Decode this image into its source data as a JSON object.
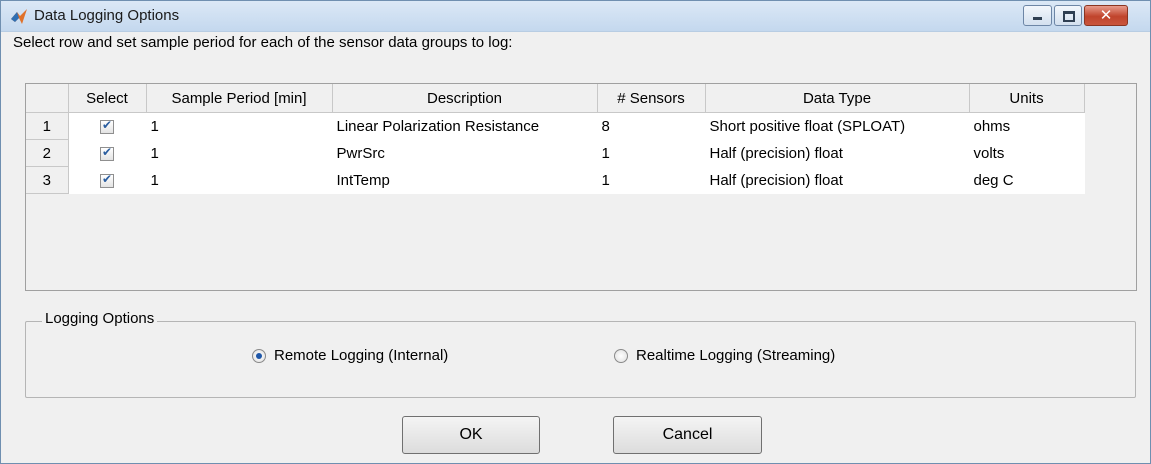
{
  "window": {
    "title": "Data Logging Options",
    "controls": {
      "minimize_icon": "minimize-icon",
      "maximize_icon": "maximize-icon",
      "close_icon": "close-icon",
      "close_glyph": "✕"
    },
    "accent_color": "#c0442c"
  },
  "instruction": "Select row and set sample period for each of the sensor data groups to log:",
  "table": {
    "columns": [
      "Select",
      "Sample Period [min]",
      "Description",
      "# Sensors",
      "Data Type",
      "Units"
    ],
    "rows": [
      {
        "index": "1",
        "selected": true,
        "sample_period": "1",
        "description": "Linear Polarization Resistance",
        "sensors": "8",
        "data_type": "Short positive float (SPLOAT)",
        "units": "ohms"
      },
      {
        "index": "2",
        "selected": true,
        "sample_period": "1",
        "description": "PwrSrc",
        "sensors": "1",
        "data_type": "Half (precision) float",
        "units": "volts"
      },
      {
        "index": "3",
        "selected": true,
        "sample_period": "1",
        "description": "IntTemp",
        "sensors": "1",
        "data_type": "Half (precision) float",
        "units": "deg C"
      }
    ]
  },
  "logging_options": {
    "legend": "Logging Options",
    "options": [
      {
        "label": "Remote Logging (Internal)",
        "selected": true
      },
      {
        "label": "Realtime Logging (Streaming)",
        "selected": false
      }
    ]
  },
  "buttons": {
    "ok": "OK",
    "cancel": "Cancel"
  }
}
